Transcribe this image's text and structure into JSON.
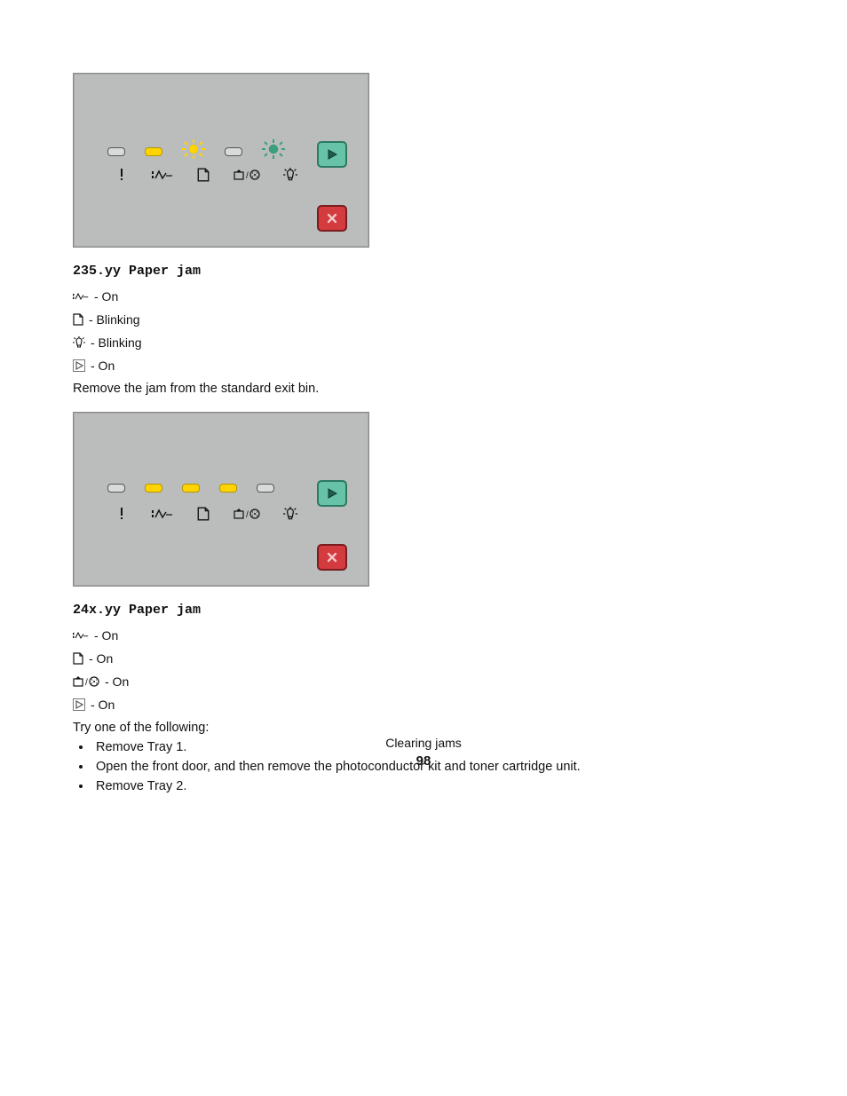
{
  "section1": {
    "heading": "235.yy Paper jam",
    "lines": [
      {
        "icon": "jam",
        "text": " - On"
      },
      {
        "icon": "paper",
        "text": " - Blinking"
      },
      {
        "icon": "tonerlight",
        "text": " - Blinking"
      },
      {
        "icon": "play",
        "text": " - On"
      }
    ],
    "body": "Remove the jam from the standard exit bin."
  },
  "section2": {
    "heading": "24x.yy Paper jam",
    "lines": [
      {
        "icon": "jam",
        "text": " - On"
      },
      {
        "icon": "paper",
        "text": " - On"
      },
      {
        "icon": "traydrum",
        "text": " - On"
      },
      {
        "icon": "play",
        "text": " - On"
      }
    ],
    "body": "Try one of the following:",
    "bullets": [
      "Remove Tray 1.",
      "Open the front door, and then remove the photoconductor kit and toner cartridge unit.",
      "Remove Tray 2."
    ]
  },
  "footer": {
    "label": "Clearing jams",
    "page": "98"
  },
  "panel1": {
    "leds": [
      "off",
      "on",
      "burst-yellow",
      "off",
      "burst-green"
    ]
  },
  "panel2": {
    "leds": [
      "off",
      "on",
      "on",
      "on",
      "off"
    ]
  }
}
